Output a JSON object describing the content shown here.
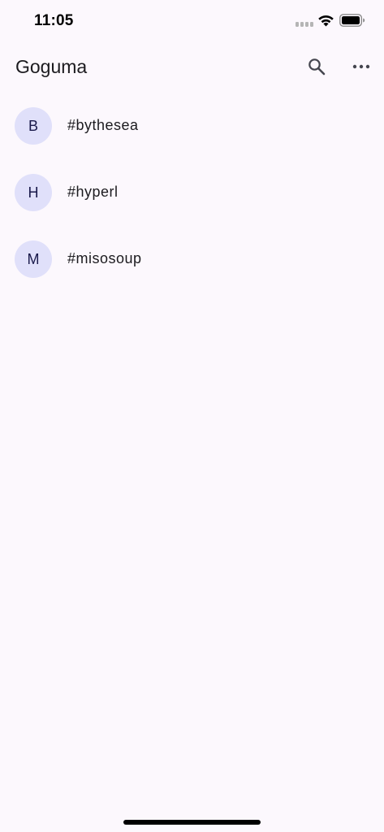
{
  "status_bar": {
    "time": "11:05"
  },
  "app_bar": {
    "title": "Goguma",
    "search_icon": "search-icon",
    "more_icon": "more-horizontal-icon"
  },
  "channels": [
    {
      "initial": "B",
      "name": "#bythesea"
    },
    {
      "initial": "H",
      "name": "#hyperl"
    },
    {
      "initial": "M",
      "name": "#misosoup"
    }
  ],
  "colors": {
    "background": "#fcf8fd",
    "avatar_bg": "#e0e0fa",
    "avatar_text": "#1a1a4b",
    "text": "#1c1b1f"
  }
}
